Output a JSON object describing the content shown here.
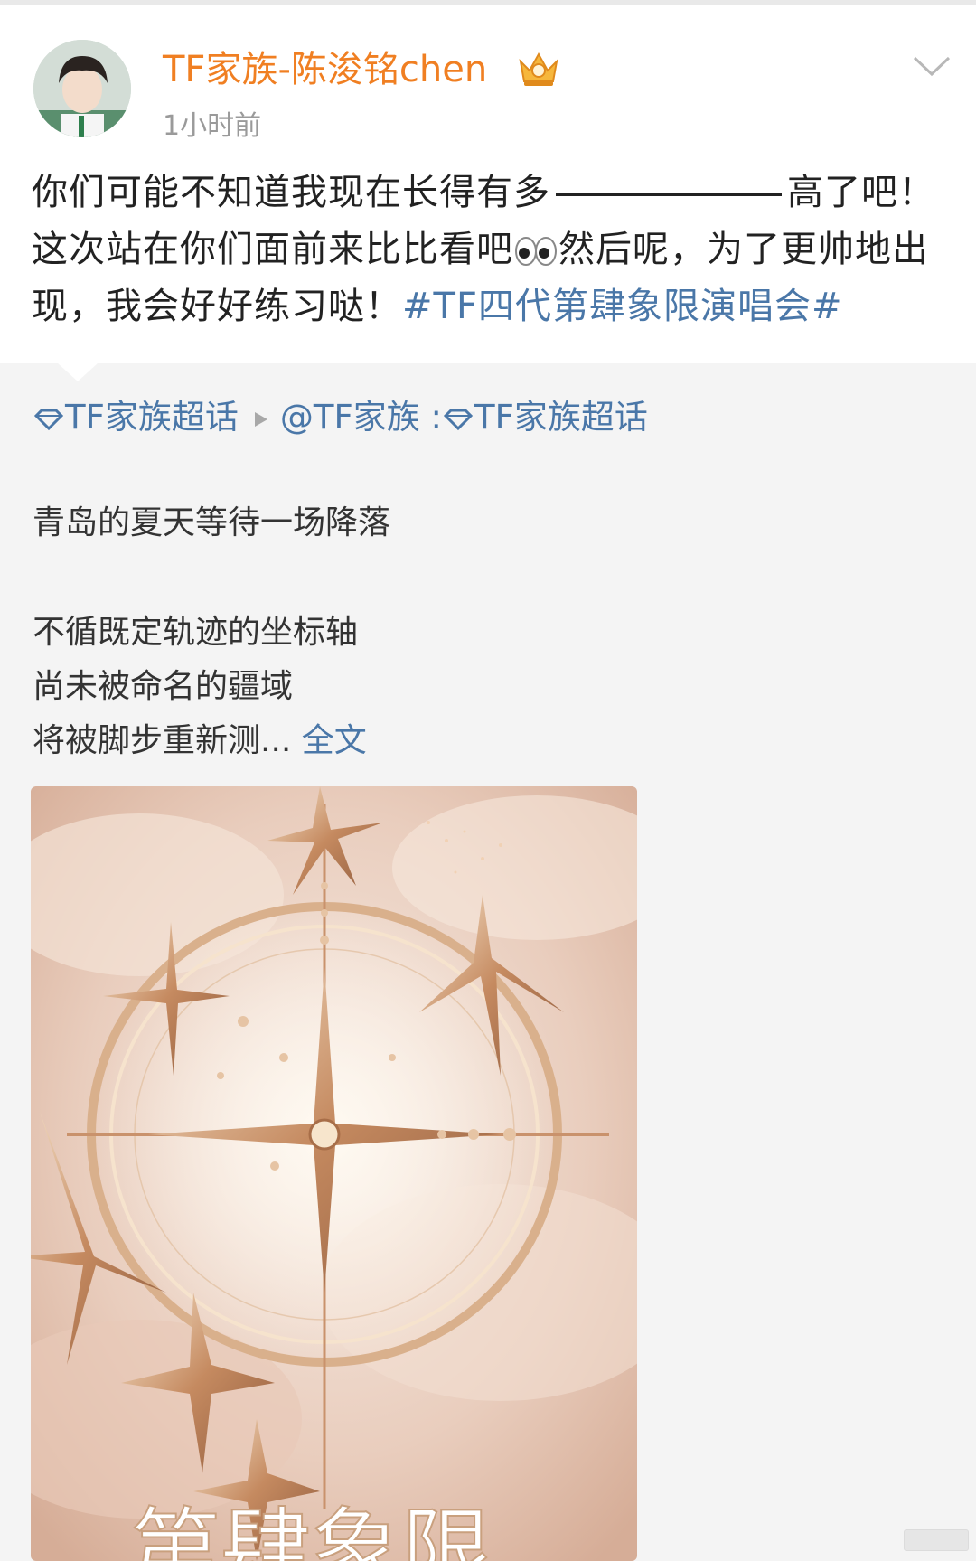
{
  "post": {
    "username": "TF家族-陈浚铭chen",
    "time": "1小时前",
    "content_part1": "你们可能不知道我现在长得有多",
    "content_part2": "高了吧！这次站在你们面前来比比看吧",
    "content_part3": "然后呢，为了更帅地出现，我会好好练习哒！",
    "hashtag": "#TF四代第肆象限演唱会#"
  },
  "repost": {
    "source": "TF家族超话",
    "at_user": "@TF家族",
    "source2": "TF家族超话",
    "lines": [
      "青岛的夏天等待一场降落",
      "不循既定轨迹的坐标轴",
      "尚未被命名的疆域",
      "将被脚步重新测..."
    ],
    "full_text_link": "全文"
  },
  "poster": {
    "title_partial": "第肆象限"
  },
  "colors": {
    "username": "#f07f22",
    "link": "#4a77a8"
  }
}
